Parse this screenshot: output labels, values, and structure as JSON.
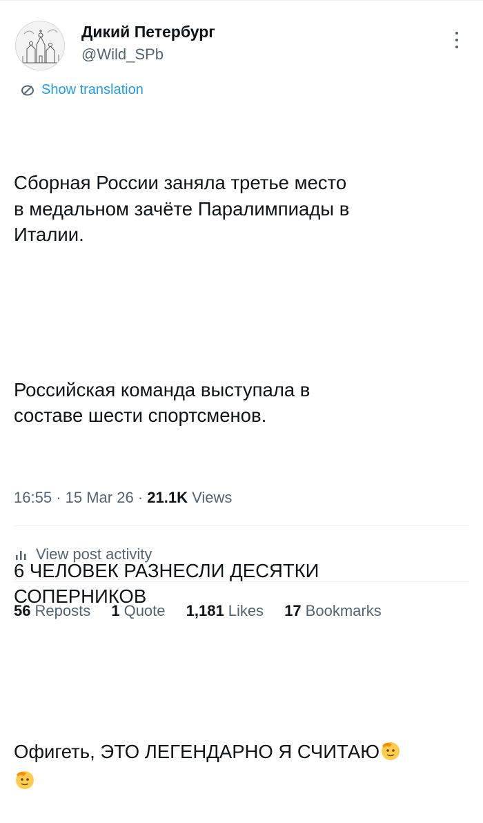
{
  "author": {
    "display_name": "Дикий Петербург",
    "handle": "@Wild_SPb"
  },
  "translate_label": "Show translation",
  "tweet": {
    "paragraphs": [
      "Сборная России заняла третье место\nв медальном зачёте Паралимпиады в\nИталии.",
      "Российская команда выступала в\nсоставе шести спортсменов.",
      "6 ЧЕЛОВЕК РАЗНЕСЛИ ДЕСЯТКИ\nСОПЕРНИКОВ",
      "Офигеть, ЭТО ЛЕГЕНДАРНО Я СЧИТАЮ"
    ],
    "emoji": "saluting-face-emoji"
  },
  "meta": {
    "time": "16:55",
    "date": "15 Mar 26",
    "views_count": "21.1K",
    "views_label": "Views"
  },
  "activity_label": "View post activity",
  "stats": {
    "reposts_count": "56",
    "reposts_label": "Reposts",
    "quotes_count": "1",
    "quotes_label": "Quote",
    "likes_count": "1,181",
    "likes_label": "Likes",
    "bookmarks_count": "17",
    "bookmarks_label": "Bookmarks"
  },
  "colors": {
    "accent": "#1d9bf0",
    "secondary_text": "#536471",
    "primary_text": "#0f1419"
  }
}
